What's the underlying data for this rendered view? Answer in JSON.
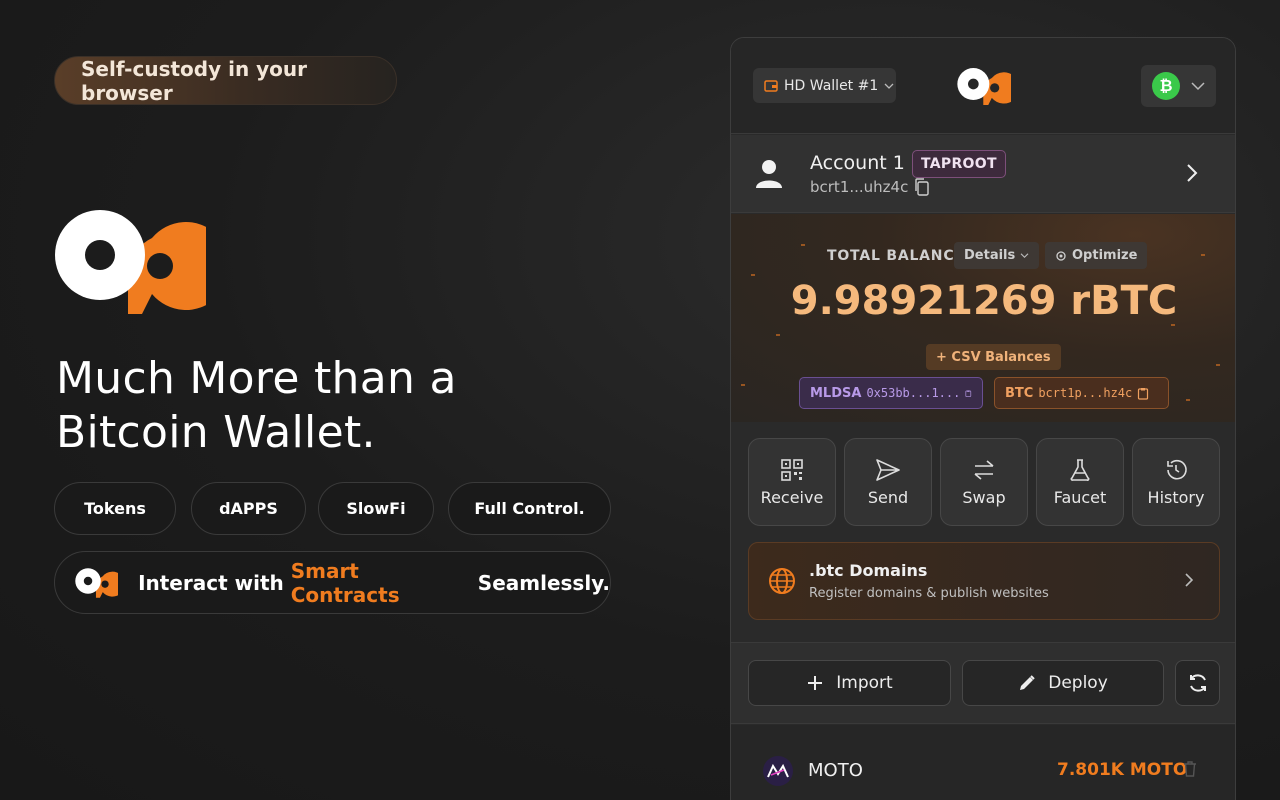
{
  "marketing": {
    "tagline": "Self-custody in your browser",
    "headline_line1": "Much More than a",
    "headline_line2": "Bitcoin Wallet.",
    "chips": [
      "Tokens",
      "dAPPS",
      "SlowFi",
      "Full Control."
    ],
    "interact_prefix": "Interact with ",
    "interact_highlight": "Smart Contracts",
    "interact_suffix": " Seamlessly."
  },
  "wallet": {
    "header": {
      "wallet_selector": "HD Wallet #1",
      "network_icon": "bitcoin-icon",
      "network_symbol": "₿"
    },
    "account": {
      "name": "Account 1",
      "type_badge": "TAPROOT",
      "address_short": "bcrt1...uhz4c"
    },
    "balance": {
      "label": "TOTAL BALANCE",
      "details_button": "Details",
      "optimize_button": "Optimize",
      "amount": "9.98921269 rBTC",
      "csv_button": "+ CSV Balances",
      "mldsa_label": "MLDSA",
      "mldsa_value": "0x53bb...1...",
      "btc_label": "BTC",
      "btc_value": "bcrt1p...hz4c"
    },
    "actions": [
      {
        "label": "Receive",
        "icon": "qr-code-icon"
      },
      {
        "label": "Send",
        "icon": "send-icon"
      },
      {
        "label": "Swap",
        "icon": "swap-icon"
      },
      {
        "label": "Faucet",
        "icon": "flask-icon"
      },
      {
        "label": "History",
        "icon": "history-icon"
      }
    ],
    "domains": {
      "title": ".btc Domains",
      "subtitle": "Register domains & publish websites"
    },
    "tools": {
      "import_label": "Import",
      "deploy_label": "Deploy"
    },
    "tokens": [
      {
        "name": "MOTO",
        "amount": "7.801K MOTO"
      }
    ]
  },
  "colors": {
    "accent": "#f07c1f",
    "balance": "#f5b97d",
    "background": "#1c1c1c",
    "panel": "#2a2a2a"
  }
}
